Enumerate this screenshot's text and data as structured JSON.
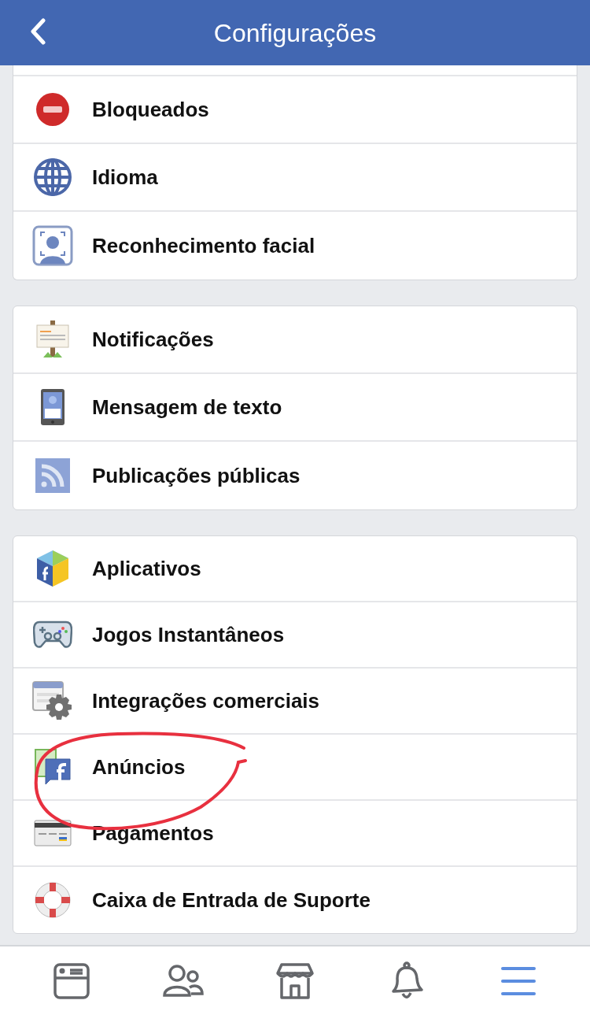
{
  "header": {
    "title": "Configurações"
  },
  "sections": [
    {
      "cut_top": true,
      "items": [
        {
          "label": "Bloqueados"
        },
        {
          "label": "Idioma"
        },
        {
          "label": "Reconhecimento facial"
        }
      ]
    },
    {
      "cut_top": false,
      "items": [
        {
          "label": "Notificações"
        },
        {
          "label": "Mensagem de texto"
        },
        {
          "label": "Publicações públicas"
        }
      ]
    },
    {
      "cut_top": false,
      "items": [
        {
          "label": "Aplicativos"
        },
        {
          "label": "Jogos Instantâneos"
        },
        {
          "label": "Integrações comerciais"
        },
        {
          "label": "Anúncios"
        },
        {
          "label": "Pagamentos"
        },
        {
          "label": "Caixa de Entrada de Suporte"
        }
      ]
    }
  ],
  "tab_bar": [
    {
      "selected": false
    },
    {
      "selected": false
    },
    {
      "selected": false
    },
    {
      "selected": false
    },
    {
      "selected": true
    }
  ]
}
